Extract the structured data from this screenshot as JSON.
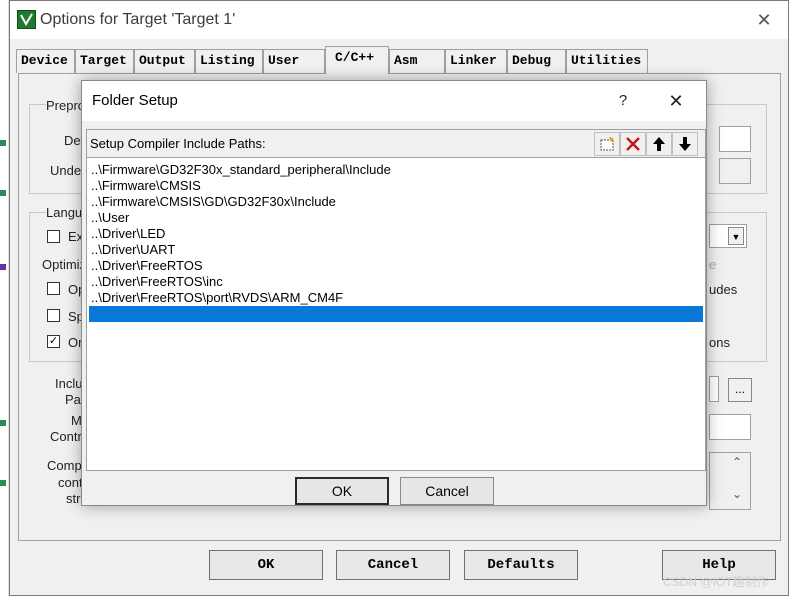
{
  "main_window": {
    "title": "Options for Target 'Target 1'",
    "close_glyph": "✕",
    "tabs": [
      {
        "label": "Device"
      },
      {
        "label": "Target"
      },
      {
        "label": "Output"
      },
      {
        "label": "Listing"
      },
      {
        "label": "User"
      },
      {
        "label": "C/C++",
        "active": true
      },
      {
        "label": "Asm"
      },
      {
        "label": "Linker"
      },
      {
        "label": "Debug"
      },
      {
        "label": "Utilities"
      }
    ],
    "background_labels": {
      "preprocessor": "Prepro",
      "define": "Def",
      "undefine": "Undef",
      "language": "Langu",
      "ex": "Ex",
      "optimize": "Optimiz",
      "op": "Op",
      "sp": "Sp",
      "on": "On",
      "include": "Inclu",
      "paths": "Pat",
      "misc": "M",
      "controls": "Contr",
      "compiler": "Comp",
      "control": "cont",
      "string": "stri",
      "right_e": "e",
      "right_udes": "udes",
      "right_ons": "ons",
      "dots": "..."
    },
    "buttons": {
      "ok": "OK",
      "cancel": "Cancel",
      "defaults": "Defaults",
      "help": "Help"
    },
    "watermark": "CSDN @IOT趣制作"
  },
  "folder_setup": {
    "title": "Folder Setup",
    "help_glyph": "?",
    "close_glyph": "✕",
    "list_label": "Setup Compiler Include Paths:",
    "toolbar": [
      "new-folder-icon",
      "delete-x-icon",
      "move-up-icon",
      "move-down-icon"
    ],
    "paths": [
      "..\\Firmware\\GD32F30x_standard_peripheral\\Include",
      "..\\Firmware\\CMSIS",
      "..\\Firmware\\CMSIS\\GD\\GD32F30x\\Include",
      "..\\User",
      "..\\Driver\\LED",
      "..\\Driver\\UART",
      "..\\Driver\\FreeRTOS",
      "..\\Driver\\FreeRTOS\\inc",
      "..\\Driver\\FreeRTOS\\port\\RVDS\\ARM_CM4F",
      ""
    ],
    "selected_index": 9,
    "ok_label": "OK",
    "cancel_label": "Cancel",
    "selection_color": "#0a78d7"
  }
}
